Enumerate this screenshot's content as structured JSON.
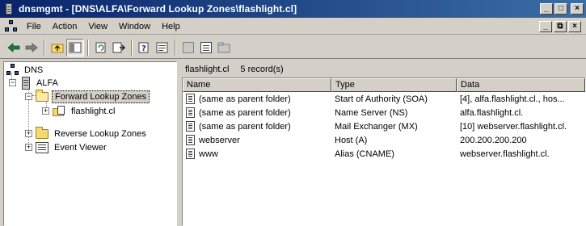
{
  "window": {
    "title": "dnsmgmt - [DNS\\ALFA\\Forward Lookup Zones\\flashlight.cl]",
    "controls": {
      "minimize": "_",
      "restore": "□",
      "close": "×"
    }
  },
  "menubar": {
    "items": [
      "File",
      "Action",
      "View",
      "Window",
      "Help"
    ],
    "doc_controls": {
      "minimize": "_",
      "restore": "⧉",
      "close": "×"
    }
  },
  "toolbar": {
    "icons": [
      "back-arrow-icon",
      "forward-arrow-icon",
      "up-folder-icon",
      "show-hide-tree-icon",
      "refresh-icon",
      "export-list-icon",
      "help-icon",
      "properties-icon",
      "server-icon",
      "new-record-icon",
      "new-folder-icon"
    ]
  },
  "tree": {
    "items": [
      {
        "label": "DNS",
        "expander": ""
      },
      {
        "label": "ALFA",
        "expander": "−"
      },
      {
        "label": "Forward Lookup Zones",
        "expander": "−"
      },
      {
        "label": "flashlight.cl",
        "expander": "+"
      },
      {
        "label": "Reverse Lookup Zones",
        "expander": "+"
      },
      {
        "label": "Event Viewer",
        "expander": "+"
      }
    ]
  },
  "details": {
    "zone_name": "flashlight.cl",
    "record_count": "5 record(s)",
    "columns": [
      "Name",
      "Type",
      "Data"
    ],
    "rows": [
      {
        "name": "(same as parent folder)",
        "type": "Start of Authority (SOA)",
        "data": "[4], alfa.flashlight.cl.,  hos..."
      },
      {
        "name": "(same as parent folder)",
        "type": "Name Server (NS)",
        "data": "alfa.flashlight.cl."
      },
      {
        "name": "(same as parent folder)",
        "type": "Mail Exchanger (MX)",
        "data": "[10]  webserver.flashlight.cl."
      },
      {
        "name": "webserver",
        "type": "Host (A)",
        "data": "200.200.200.200"
      },
      {
        "name": "www",
        "type": "Alias (CNAME)",
        "data": "webserver.flashlight.cl."
      }
    ]
  },
  "colors": {
    "titlebar_start": "#0a246a",
    "titlebar_end": "#3a6ea5",
    "face": "#d4d0c8"
  }
}
